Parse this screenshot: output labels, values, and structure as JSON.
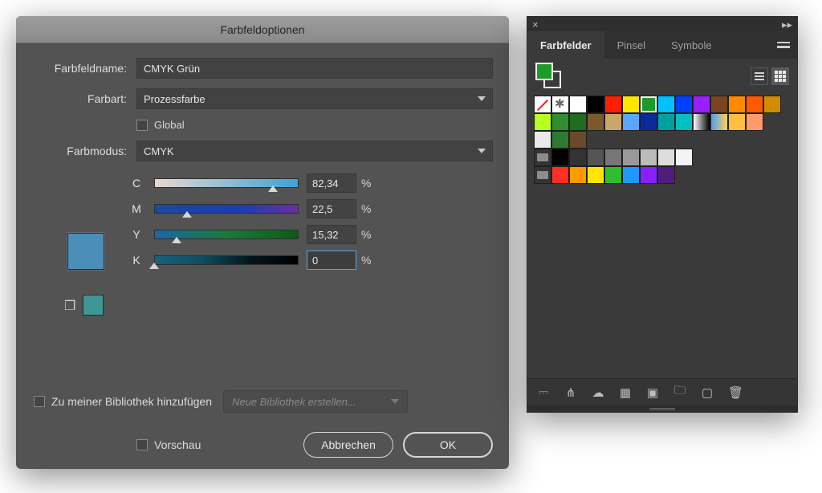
{
  "dialog": {
    "title": "Farbfeldoptionen",
    "name_label": "Farbfeldname:",
    "name_value": "CMYK Grün",
    "type_label": "Farbart:",
    "type_value": "Prozessfarbe",
    "global_label": "Global",
    "mode_label": "Farbmodus:",
    "mode_value": "CMYK",
    "channels": {
      "c": {
        "label": "C",
        "value": "82,34",
        "pct": "%",
        "pos": 82.34
      },
      "m": {
        "label": "M",
        "value": "22,5",
        "pct": "%",
        "pos": 22.5
      },
      "y": {
        "label": "Y",
        "value": "15,32",
        "pct": "%",
        "pos": 15.32
      },
      "k": {
        "label": "K",
        "value": "0",
        "pct": "%",
        "pos": 0
      }
    },
    "lib_checkbox": "Zu meiner Bibliothek hinzufügen",
    "lib_select": "Neue Bibliothek erstellen...",
    "preview_label": "Vorschau",
    "cancel": "Abbrechen",
    "ok": "OK",
    "preview_color": "#4b8eb7",
    "global_color": "#3f9696"
  },
  "panel": {
    "tabs": [
      "Farbfelder",
      "Pinsel",
      "Symbole"
    ],
    "active_tab": 0,
    "fill_color": "#1e9a28",
    "rows": [
      [
        "none",
        "reg",
        "#ffffff",
        "#000000",
        "#ff1e00",
        "#ffe600",
        "#1e9a28",
        "#00c2ff",
        "#0040ff",
        "#9a1fff",
        "#7a441e",
        "#ff8a00",
        "#ff5a00",
        "#d38c00"
      ],
      [
        "#b6ff1e",
        "#2e8f2e",
        "#1e6e1e",
        "#7a5a2a",
        "#caa66a",
        "#5aa6ff",
        "#0a2a9a",
        "#00a0a0",
        "#00c0c0",
        "grad1",
        "grad2",
        "#ffbf3f",
        "#ff9a6a"
      ],
      [
        "#e9e9e9",
        "#2e7a2e",
        "#6b4a2a"
      ],
      [
        "folder",
        "#000000",
        "#333333",
        "#555555",
        "#777777",
        "#999999",
        "#bbbbbb",
        "#dddddd",
        "#f4f4f4"
      ],
      [
        "folder",
        "#ff3020",
        "#ff9a00",
        "#ffe600",
        "#2ebf2e",
        "#1e9aff",
        "#8a1fff",
        "#4a1f7a"
      ]
    ],
    "selected": [
      0,
      6
    ]
  }
}
